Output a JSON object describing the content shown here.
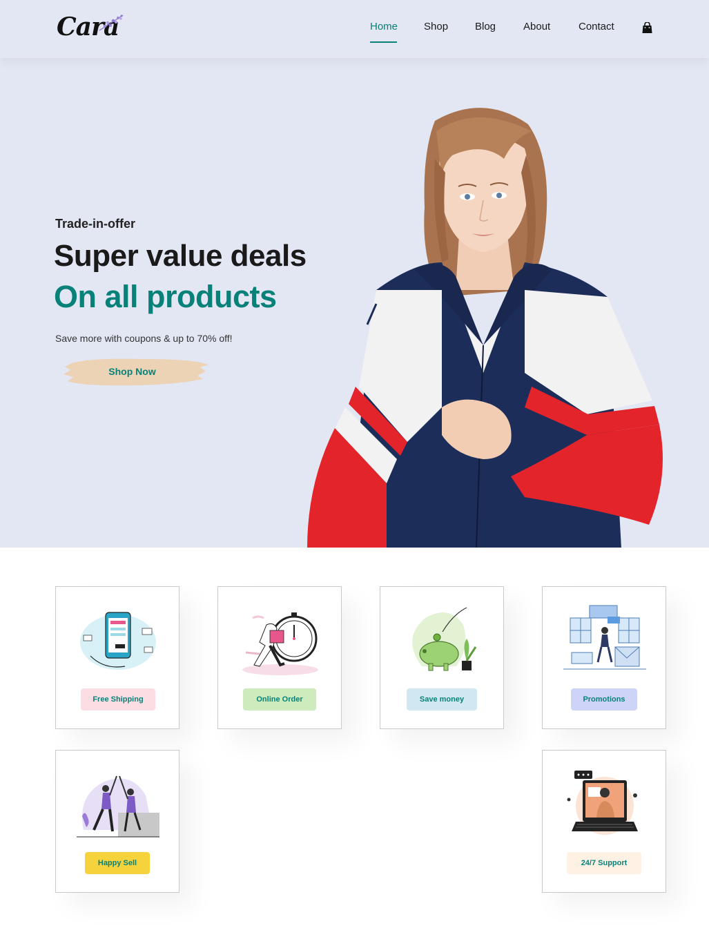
{
  "brand": {
    "name": "Cara"
  },
  "nav": {
    "items": [
      {
        "label": "Home",
        "active": true
      },
      {
        "label": "Shop",
        "active": false
      },
      {
        "label": "Blog",
        "active": false
      },
      {
        "label": "About",
        "active": false
      },
      {
        "label": "Contact",
        "active": false
      }
    ],
    "cart_icon": "shopping-bag-icon"
  },
  "hero": {
    "kicker": "Trade-in-offer",
    "title_line1": "Super value deals",
    "title_line2": "On all products",
    "subtitle": "Save more with coupons & up to 70% off!",
    "cta_label": "Shop Now"
  },
  "features": [
    {
      "label": "Free Shipping",
      "tag_color": "#fddde4"
    },
    {
      "label": "Online Order",
      "tag_color": "#cdebbc"
    },
    {
      "label": "Save money",
      "tag_color": "#d1e8f2"
    },
    {
      "label": "Promotions",
      "tag_color": "#cdd4f8"
    },
    {
      "label": "Happy Sell",
      "tag_color": "#f6dbf6"
    },
    {
      "label": "24/7 Support",
      "tag_color": "#fff2e5"
    }
  ],
  "colors": {
    "accent": "#088178",
    "hero_bg": "#e3e6f3",
    "happy_sell_tag": "#f6d23c",
    "shop_now_brush": "#ecd3b6"
  }
}
